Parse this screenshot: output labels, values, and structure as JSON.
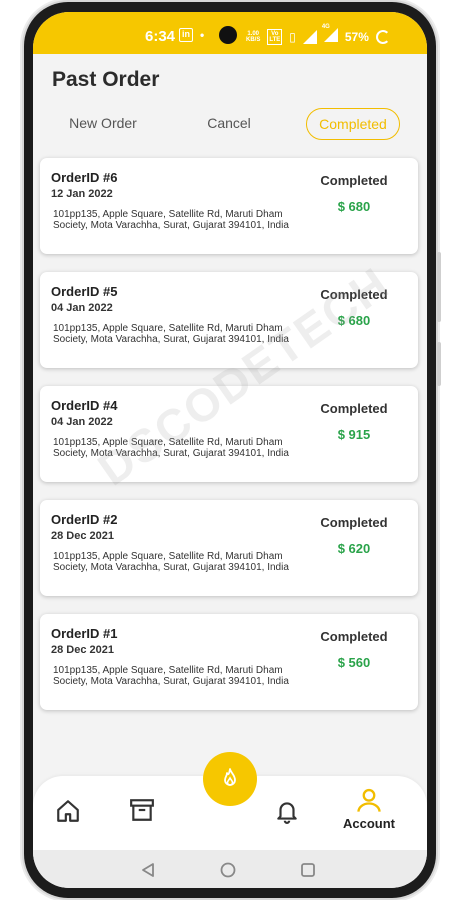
{
  "status_bar": {
    "time": "6:34",
    "battery": "57%",
    "icons": [
      "linkedin-icon",
      "dot",
      "network-speed",
      "volte-icon",
      "vibrate-icon",
      "signal-icon",
      "4g-signal-icon",
      "battery-icon"
    ],
    "speed_top": "1.00",
    "speed_bottom": "KB/S",
    "volte_top": "Vo",
    "volte_bottom": "LTE",
    "network": "4G"
  },
  "page": {
    "title": "Past Order"
  },
  "tabs": [
    {
      "label": "New Order",
      "active": false
    },
    {
      "label": "Cancel",
      "active": false
    },
    {
      "label": "Completed",
      "active": true
    }
  ],
  "orders": [
    {
      "id": "OrderID #6",
      "date": "12 Jan 2022",
      "address": "101pp135, Apple Square, Satellite Rd, Maruti Dham Society, Mota Varachha, Surat, Gujarat 394101, India",
      "status": "Completed",
      "amount": "$ 680"
    },
    {
      "id": "OrderID #5",
      "date": "04 Jan 2022",
      "address": "101pp135, Apple Square, Satellite Rd, Maruti Dham Society, Mota Varachha, Surat, Gujarat 394101, India",
      "status": "Completed",
      "amount": "$ 680"
    },
    {
      "id": "OrderID #4",
      "date": "04 Jan 2022",
      "address": "101pp135, Apple Square, Satellite Rd, Maruti Dham Society, Mota Varachha, Surat, Gujarat 394101, India",
      "status": "Completed",
      "amount": "$ 915"
    },
    {
      "id": "OrderID #2",
      "date": "28 Dec 2021",
      "address": "101pp135, Apple Square, Satellite Rd, Maruti Dham Society, Mota Varachha, Surat, Gujarat 394101, India",
      "status": "Completed",
      "amount": "$ 620"
    },
    {
      "id": "OrderID #1",
      "date": "28 Dec 2021",
      "address": "101pp135, Apple Square, Satellite Rd, Maruti Dham Society, Mota Varachha, Surat, Gujarat 394101, India",
      "status": "Completed",
      "amount": "$ 560"
    }
  ],
  "watermark": "DSCODETECH",
  "bottom_nav": {
    "items": [
      {
        "icon": "home-icon"
      },
      {
        "icon": "archive-box-icon"
      },
      {
        "icon": "bell-icon"
      },
      {
        "icon": "account-icon",
        "label": "Account",
        "active": true
      }
    ],
    "fab_icon": "flame-icon"
  },
  "system_nav": [
    "back-icon",
    "home-circle-icon",
    "recents-icon"
  ],
  "colors": {
    "accent": "#f6c700",
    "amount": "#2aa34a",
    "tab_active": "#f2bd00"
  }
}
